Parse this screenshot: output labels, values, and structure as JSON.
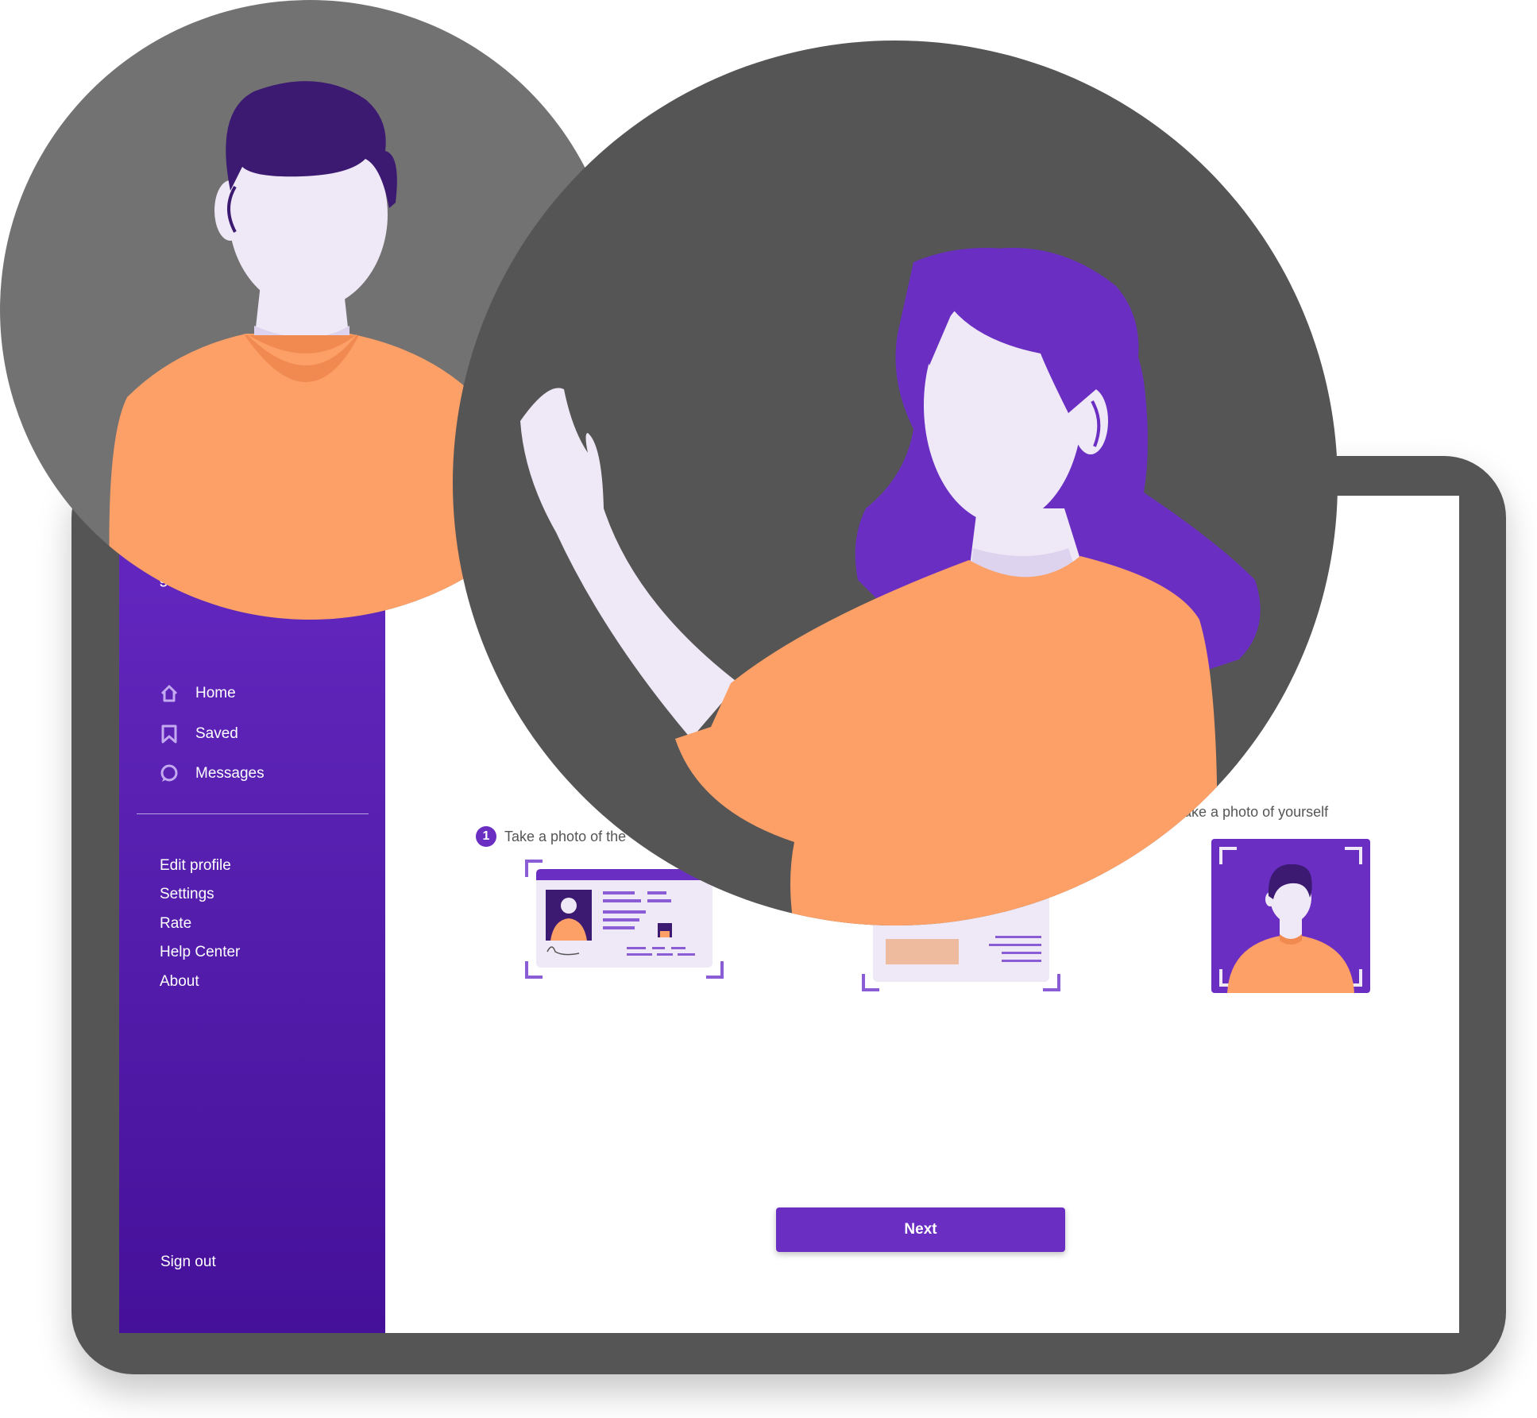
{
  "sidebar": {
    "brand": "g",
    "nav": [
      {
        "label": "Home",
        "icon": "home-icon"
      },
      {
        "label": "Saved",
        "icon": "bookmark-icon"
      },
      {
        "label": "Messages",
        "icon": "chat-icon"
      }
    ],
    "menu": [
      "Edit profile",
      "Settings",
      "Rate",
      "Help Center",
      "About"
    ],
    "sign_out": "Sign out"
  },
  "steps": [
    {
      "number": "1",
      "text": "Take a photo of the"
    },
    {
      "text": "ake a photo of yourself"
    }
  ],
  "next_button": "Next",
  "colors": {
    "accent": "#6a2fc2",
    "sidebar_top": "#6528c2",
    "sidebar_bottom": "#45109a",
    "shirt": "#fca068",
    "skin": "#efe9f7",
    "hair_dark": "#3d1a72",
    "hair_purple": "#6a2fc2",
    "circle_light": "#727272",
    "circle_dark": "#555555",
    "tablet_frame": "#555555"
  }
}
